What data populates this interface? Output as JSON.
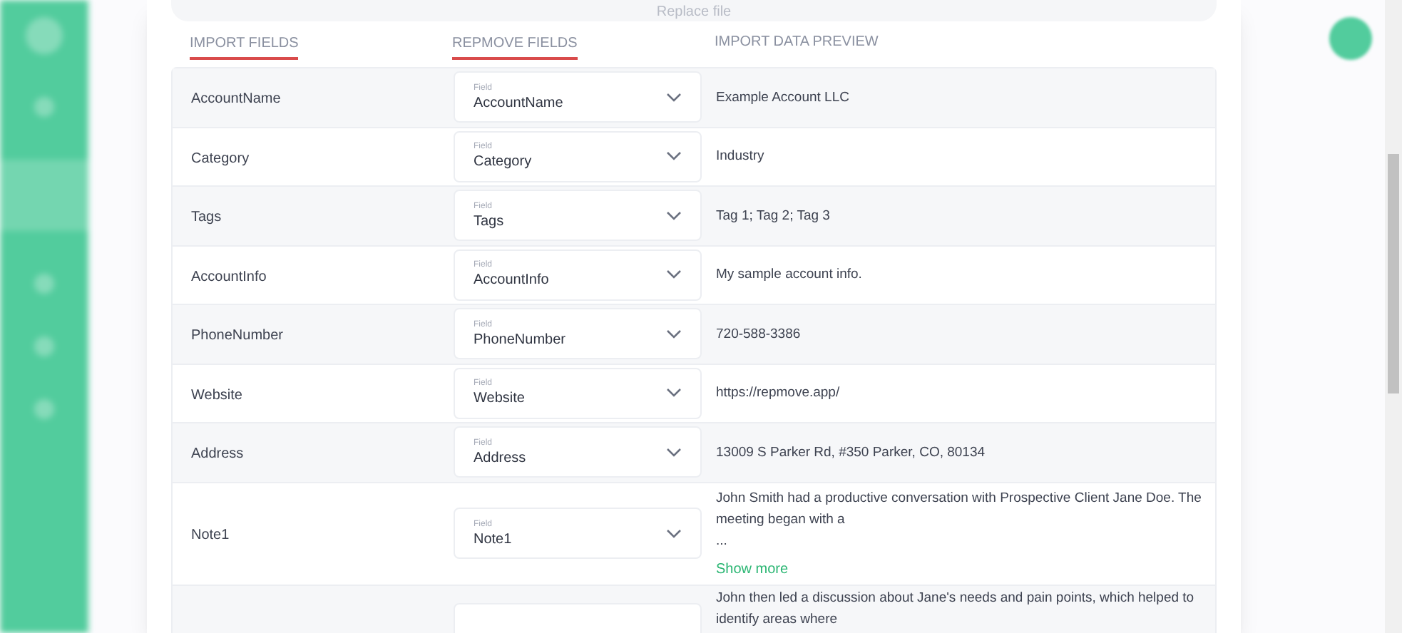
{
  "replace_file": "Replace file",
  "headers": [
    {
      "label": "IMPORT FIELDS",
      "underlined": true
    },
    {
      "label": "REPMOVE FIELDS",
      "underlined": true
    },
    {
      "label": "IMPORT DATA PREVIEW",
      "underlined": false
    }
  ],
  "rows": [
    {
      "name": "AccountName",
      "field_label": "Field",
      "field_value": "AccountName",
      "preview": [
        "Example Account LLC"
      ]
    },
    {
      "name": "Category",
      "field_label": "Field",
      "field_value": "Category",
      "preview": [
        "Industry"
      ]
    },
    {
      "name": "Tags",
      "field_label": "Field",
      "field_value": "Tags",
      "preview": [
        "Tag 1; Tag 2; Tag 3"
      ]
    },
    {
      "name": "AccountInfo",
      "field_label": "Field",
      "field_value": "AccountInfo",
      "preview": [
        "My sample account info."
      ]
    },
    {
      "name": "PhoneNumber",
      "field_label": "Field",
      "field_value": "PhoneNumber",
      "preview": [
        "720-588-3386"
      ]
    },
    {
      "name": "Website",
      "field_label": "Field",
      "field_value": "Website",
      "preview": [
        "https://repmove.app/"
      ]
    },
    {
      "name": "Address",
      "field_label": "Field",
      "field_value": "Address",
      "preview": [
        "13009 S Parker Rd, #350 Parker, CO, 80134"
      ]
    },
    {
      "name": "Note1",
      "field_label": "Field",
      "field_value": "Note1",
      "preview": [
        "John Smith had a productive conversation with Prospective Client Jane Doe. The",
        "meeting began with a",
        "..."
      ],
      "show_more": "Show more"
    },
    {
      "preview": [
        "John then led a discussion about Jane's needs and pain points, which helped to",
        "identify areas where"
      ]
    }
  ]
}
